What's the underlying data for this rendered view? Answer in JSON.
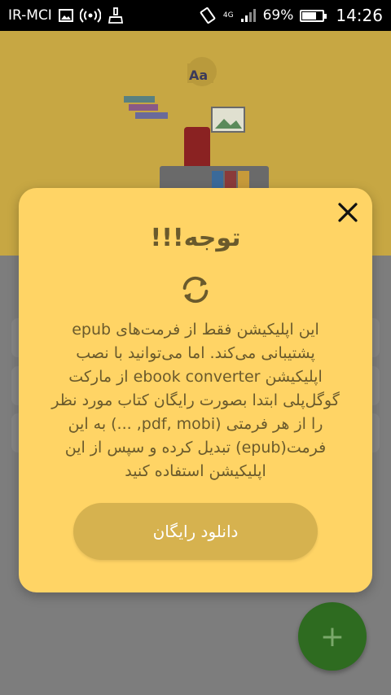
{
  "status_bar": {
    "carrier": "IR-MCI",
    "network": "4G",
    "battery_percent_text": "69%",
    "battery_level": 0.69,
    "time": "14:26"
  },
  "dialog": {
    "title": "توجه!!!",
    "body": "این اپلیکیشن فقط از فرمت‌های epub پشتیبانی می‌کند. اما می‌توانید با نصب اپلیکیشن ebook converter از مارکت گوگل‌پلی ابتدا بصورت رایگان کتاب مورد نظر را از هر فرمتی (pdf, mobi, ...) به این فرمت(epub) تبدیل کرده و سپس از این اپلیکیشن استفاده کنید",
    "download_label": "دانلود رایگان"
  },
  "fab": {
    "label": "+"
  },
  "icons": {
    "close": "close-icon",
    "sync": "sync-icon",
    "gallery": "image-icon",
    "hotspot": "hotspot-icon",
    "cleaner": "broom-icon",
    "rotate": "screen-rotation-icon",
    "signal": "signal-icon",
    "battery": "battery-icon"
  },
  "colors": {
    "dialog_bg": "#ffd465",
    "button_bg": "#d6b24f",
    "text": "#6a5a2c",
    "fab": "#2e6b20"
  }
}
